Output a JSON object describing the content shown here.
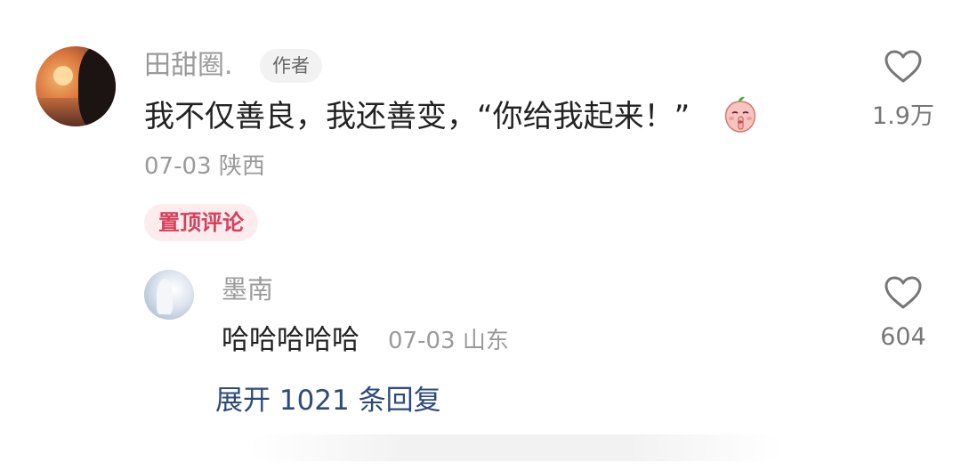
{
  "comment": {
    "username": "田甜圈.",
    "author_badge": "作者",
    "text": "我不仅善良，我还善变，“你给我起来！”",
    "emoji_icon": "shush-peach-emoji",
    "date": "07-03",
    "location": "陕西",
    "meta": "07-03 陕西",
    "pinned_label": "置顶评论",
    "like_count": "1.9万"
  },
  "reply": {
    "username": "墨南",
    "text": "哈哈哈哈哈",
    "meta": "07-03 山东",
    "like_count": "604"
  },
  "expand_replies": "展开 1021 条回复",
  "colors": {
    "pinned_text": "#d6405a",
    "pinned_bg": "#fdecee",
    "link": "#2d4a7a"
  }
}
